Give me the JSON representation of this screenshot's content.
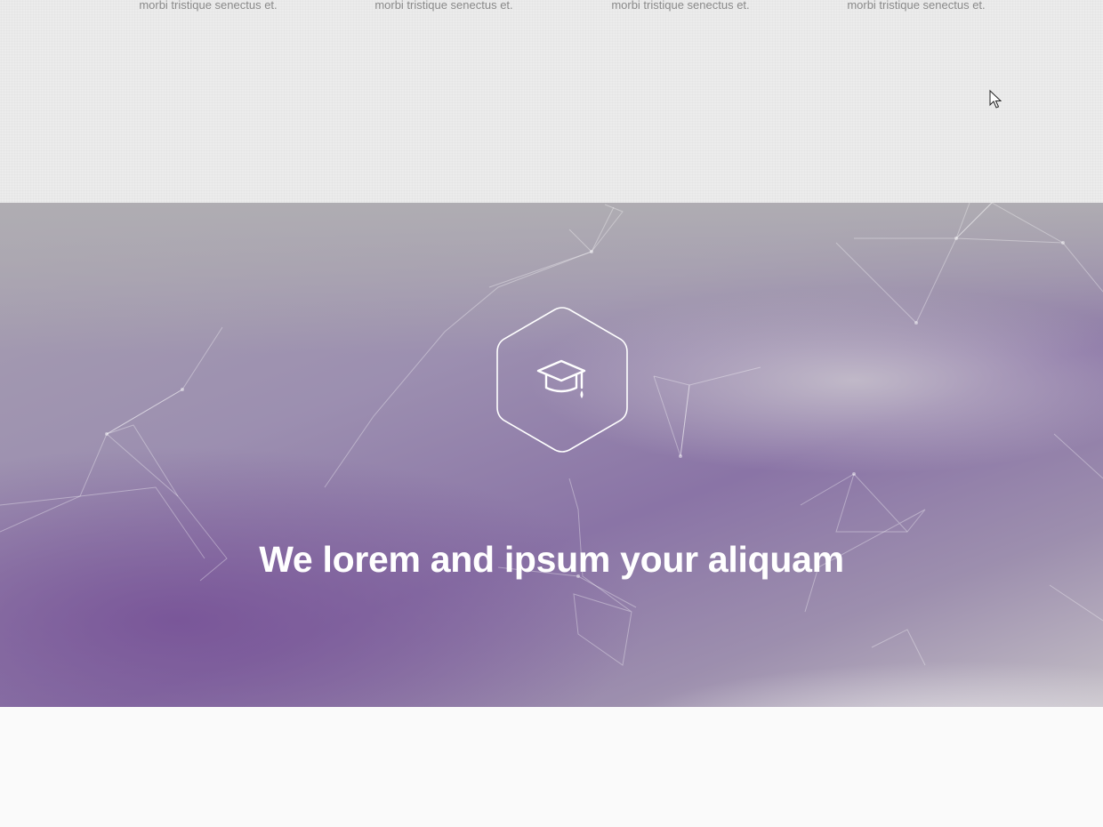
{
  "features": {
    "items": [
      {
        "text": "morbi tristique senectus et."
      },
      {
        "text": "morbi tristique senectus et."
      },
      {
        "text": "morbi tristique senectus et."
      },
      {
        "text": "morbi tristique senectus et."
      }
    ]
  },
  "hero": {
    "icon": "graduation-cap-icon",
    "title": "We lorem and ipsum your aliquam"
  },
  "colors": {
    "features_bg": "#ececec",
    "feature_text": "#8a8a8a",
    "hero_purple": "#8a74a6",
    "hero_title": "#ffffff",
    "bottom_bg": "#fafafa"
  }
}
